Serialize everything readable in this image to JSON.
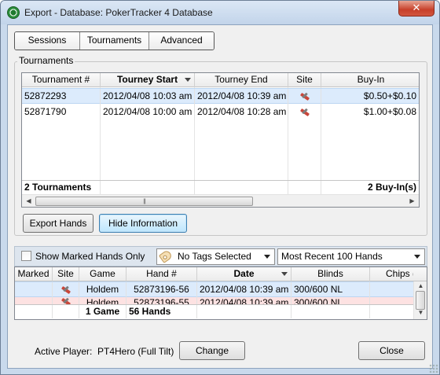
{
  "window": {
    "title": "Export - Database: PokerTracker 4 Database",
    "close_glyph": "✕"
  },
  "tabs": [
    {
      "label": "Sessions"
    },
    {
      "label": "Tournaments"
    },
    {
      "label": "Advanced"
    }
  ],
  "tournaments_group": {
    "label": "Tournaments",
    "columns": [
      "Tournament #",
      "Tourney Start",
      "Tourney End",
      "Site",
      "Buy-In"
    ],
    "sorted_column": "Tourney Start",
    "rows": [
      {
        "id": "52872293",
        "start": "2012/04/08 10:03 am",
        "end": "2012/04/08 10:39 am",
        "site_icon": "full-tilt-icon",
        "buyin": "$0.50+$0.10",
        "selected": true
      },
      {
        "id": "52871790",
        "start": "2012/04/08 10:00 am",
        "end": "2012/04/08 10:28 am",
        "site_icon": "full-tilt-icon",
        "buyin": "$1.00+$0.08",
        "selected": false
      }
    ],
    "footer_count": "2 Tournaments",
    "footer_buyins": "2 Buy-In(s)"
  },
  "buttons": {
    "export_hands": "Export Hands",
    "hide_information": "Hide Information",
    "change": "Change",
    "close": "Close"
  },
  "filter_bar": {
    "show_marked_label": "Show Marked Hands Only",
    "show_marked_checked": false,
    "tags_selected": "No Tags Selected",
    "hands_range": "Most Recent 100 Hands"
  },
  "hands_grid": {
    "columns": [
      "Marked",
      "Site",
      "Game",
      "Hand #",
      "Date",
      "Blinds",
      "Chips (B"
    ],
    "sorted_column": "Date",
    "rows": [
      {
        "marked": "",
        "site_icon": "full-tilt-icon",
        "game": "Holdem",
        "hand": "52873196-56",
        "date": "2012/04/08 10:39 am",
        "blinds": "300/600 NL",
        "chips": "",
        "selected": true
      },
      {
        "marked": "",
        "site_icon": "full-tilt-icon",
        "game": "Holdem",
        "hand": "52873196-55",
        "date": "2012/04/08 10:39 am",
        "blinds": "300/600 NL",
        "chips": "",
        "selected": false
      }
    ],
    "footer_games": "1 Game",
    "footer_hands": "56 Hands"
  },
  "active_player": {
    "label": "Active Player:",
    "value": "PT4Hero (Full Tilt)"
  },
  "colors": {
    "window_frame": "#c9d9ec",
    "close_button": "#c7402a",
    "selected_row": "#dcebfc",
    "second_row_tint": "#fde2e2",
    "focused_button": "#bee6fd"
  }
}
